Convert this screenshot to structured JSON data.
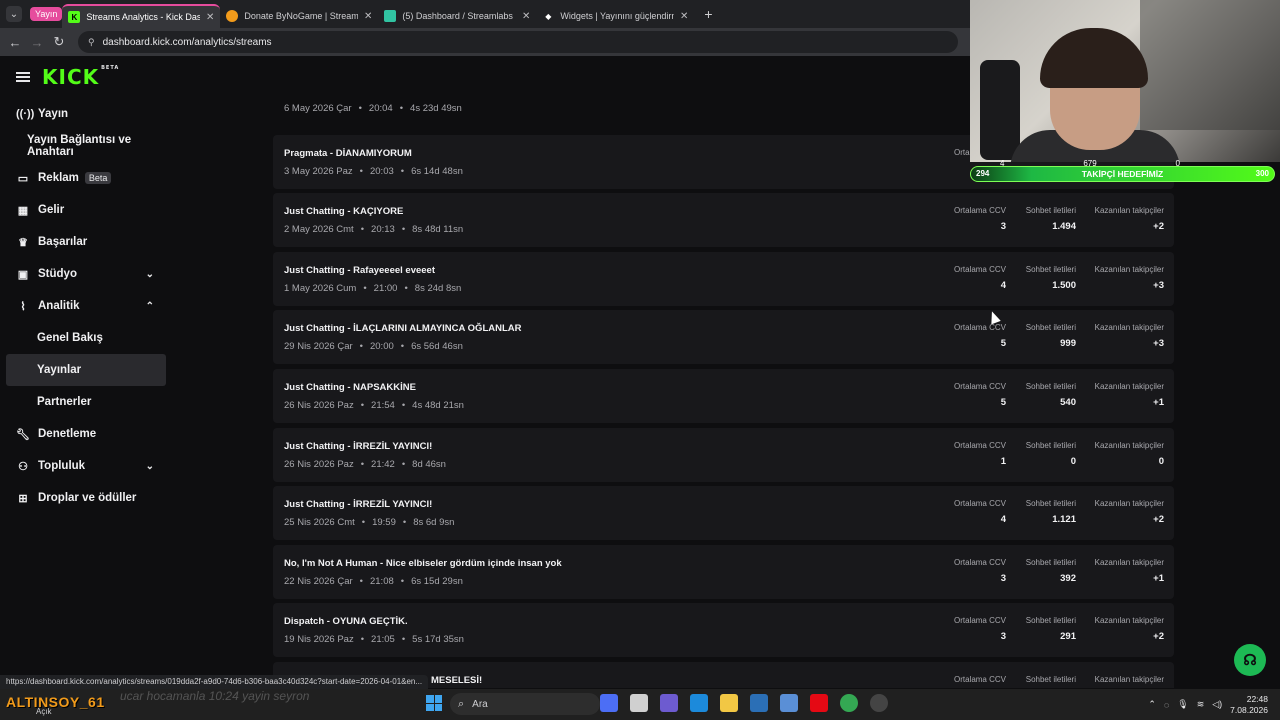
{
  "browser": {
    "group_label": "Yayın",
    "tabs": [
      {
        "title": "Streams Analytics - Kick Dashboard",
        "active": true
      },
      {
        "title": "Donate ByNoGame | Streamer Dashboard",
        "active": false
      },
      {
        "title": "(5) Dashboard / Streamlabs",
        "active": false
      },
      {
        "title": "Widgets | Yayınını güçlendirmek",
        "active": false
      }
    ],
    "url": "dashboard.kick.com/analytics/streams",
    "status_url": "https://dashboard.kick.com/analytics/streams/019dda2f-a9d0-74d6-b306-baa3c40d324c?start-date=2026-04-01&en..."
  },
  "app": {
    "logo": "KICK",
    "logo_badge": "BETA"
  },
  "sidebar": {
    "items": [
      {
        "label": "Yayın",
        "icon": "broadcast-icon"
      },
      {
        "label": "Yayın Bağlantısı ve Anahtarı"
      },
      {
        "label": "Reklam",
        "icon": "ad-icon",
        "badge": "Beta"
      },
      {
        "label": "Gelir",
        "icon": "revenue-icon"
      },
      {
        "label": "Başarılar",
        "icon": "trophy-icon"
      },
      {
        "label": "Stüdyo",
        "icon": "studio-icon",
        "chevron": "down"
      },
      {
        "label": "Analitik",
        "icon": "analytics-icon",
        "chevron": "up"
      },
      {
        "label": "Genel Bakış"
      },
      {
        "label": "Yayınlar",
        "selected": true
      },
      {
        "label": "Partnerler"
      },
      {
        "label": "Denetleme",
        "icon": "wrench-icon"
      },
      {
        "label": "Topluluk",
        "icon": "community-icon",
        "chevron": "down"
      },
      {
        "label": "Droplar ve ödüller",
        "icon": "gift-icon"
      }
    ]
  },
  "stat_labels": {
    "ccv": "Ortalama CCV",
    "chat": "Sohbet iletileri",
    "followers": "Kazanılan takipçiler"
  },
  "streams": [
    {
      "title": "",
      "date": "6 May 2026 Çar",
      "time": "20:04",
      "duration": "4s 23d 49sn",
      "partial": true
    },
    {
      "title": "Pragmata - DİANAMIYORUM",
      "date": "3 May 2026 Paz",
      "time": "20:03",
      "duration": "6s 14d 48sn",
      "ccv": "",
      "chat": "",
      "followers": "",
      "hidden_stats": true
    },
    {
      "title": "Just Chatting - KAÇIYORE",
      "date": "2 May 2026 Cmt",
      "time": "20:13",
      "duration": "8s 48d 11sn",
      "ccv": "3",
      "chat": "1.494",
      "followers": "+2"
    },
    {
      "title": "Just Chatting - Rafayeeeel eveeet",
      "date": "1 May 2026 Cum",
      "time": "21:00",
      "duration": "8s 24d 8sn",
      "ccv": "4",
      "chat": "1.500",
      "followers": "+3"
    },
    {
      "title": "Just Chatting - İLAÇLARINI ALMAYINCA OĞLANLAR",
      "date": "29 Nis 2026 Çar",
      "time": "20:00",
      "duration": "6s 56d 46sn",
      "ccv": "5",
      "chat": "999",
      "followers": "+3"
    },
    {
      "title": "Just Chatting - NAPSAKKİNE",
      "date": "26 Nis 2026 Paz",
      "time": "21:54",
      "duration": "4s 48d 21sn",
      "ccv": "5",
      "chat": "540",
      "followers": "+1"
    },
    {
      "title": "Just Chatting - İRREZİL YAYINCI!",
      "date": "26 Nis 2026 Paz",
      "time": "21:42",
      "duration": "8d 46sn",
      "ccv": "1",
      "chat": "0",
      "followers": "0"
    },
    {
      "title": "Just Chatting - İRREZİL YAYINCI!",
      "date": "25 Nis 2026 Cmt",
      "time": "19:59",
      "duration": "8s 6d 9sn",
      "ccv": "4",
      "chat": "1.121",
      "followers": "+2"
    },
    {
      "title": "No, I'm Not A Human - Nice elbiseler gördüm içinde insan yok",
      "date": "22 Nis 2026 Çar",
      "time": "21:08",
      "duration": "6s 15d 29sn",
      "ccv": "3",
      "chat": "392",
      "followers": "+1"
    },
    {
      "title": "Dispatch - OYUNA GEÇTİK.",
      "date": "19 Nis 2026 Paz",
      "time": "21:05",
      "duration": "5s 17d 35sn",
      "ccv": "3",
      "chat": "291",
      "followers": "+2"
    },
    {
      "title": "MESELESİ!",
      "date": "",
      "time": "",
      "duration": "",
      "ccv": "",
      "chat": "",
      "followers": "",
      "partial_bottom": true
    }
  ],
  "overlay": {
    "goal_nums": [
      "4",
      "679",
      "0"
    ],
    "goal_left": "294",
    "goal_title": "TAKİPÇİ HEDEFİMİZ",
    "goal_right": "300"
  },
  "taskbar": {
    "streamer_name": "ALTINSOY_61",
    "streamer_sub": "Açık",
    "ghost_text": "ucar hocamanla 10:24 yayin seyron",
    "search_placeholder": "Ara",
    "time": "22:48",
    "date": "7.08.2026"
  }
}
